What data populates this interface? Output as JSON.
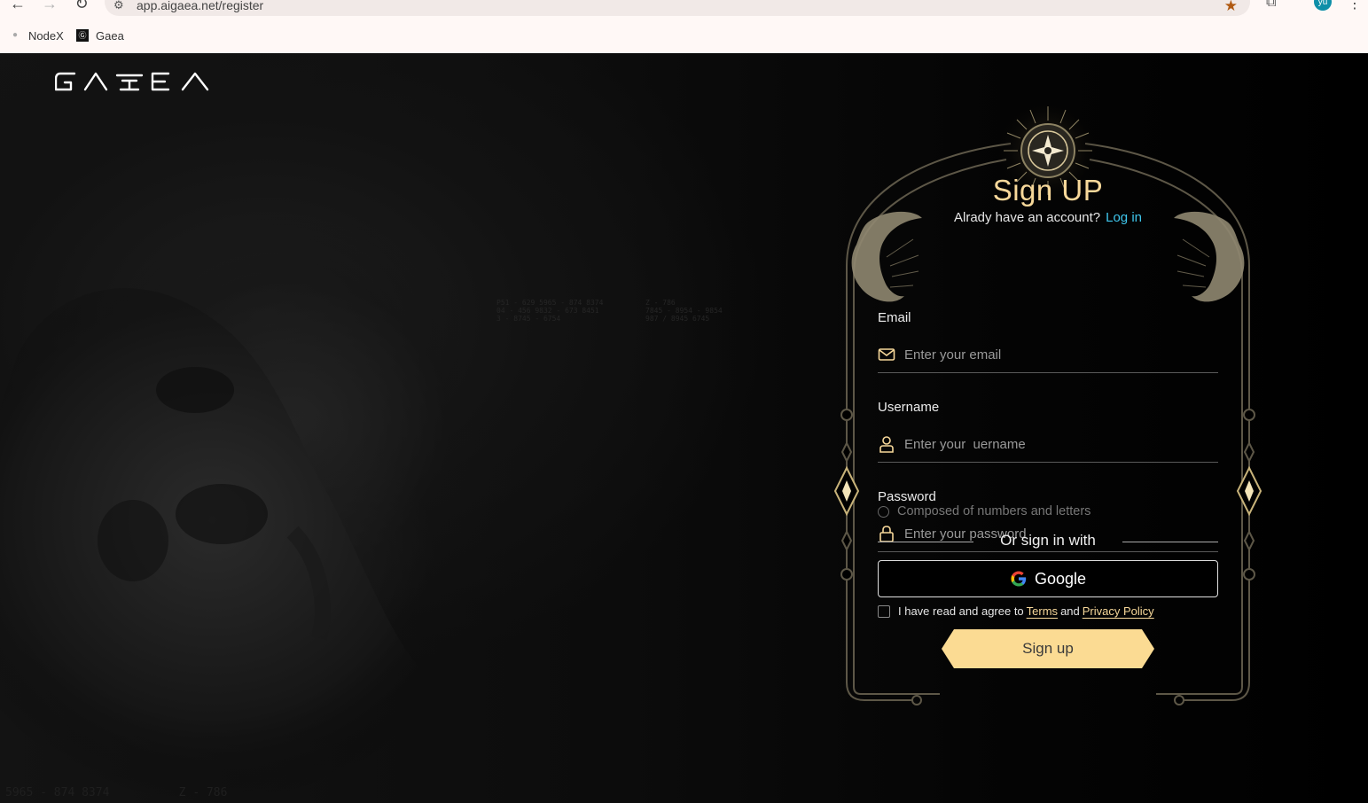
{
  "browser": {
    "url": "app.aigaea.net/register",
    "bookmarks": [
      {
        "label": "NodeX",
        "icon": "paw-icon"
      },
      {
        "label": "Gaea",
        "icon": "gaea-favicon"
      }
    ],
    "profile_initials": "yu"
  },
  "page": {
    "logo_text": "GAEA",
    "faint_text_1": "P51 - 629 5965 - 874 8374\n04 - 456 9832 - 673 8451\n3 - 8745 - 6754",
    "faint_text_2": "Z - 786\n7845 - 8954 - 9854\n987 / 8945 6745",
    "faint_text_3": "5965 - 874 8374          Z - 786"
  },
  "form": {
    "title": "Sign UP",
    "have_account": "Alrady have an account?",
    "login_link": "Log in",
    "email": {
      "label": "Email",
      "placeholder": "Enter your email",
      "value": ""
    },
    "username": {
      "label": "Username",
      "placeholder": "Enter your  uername",
      "value": ""
    },
    "password": {
      "label": "Password",
      "placeholder": "Enter your password",
      "value": ""
    },
    "password_hint": "Composed of numbers and letters",
    "or_text": "Or sign in with",
    "google_label": "Google",
    "agree_prefix": "I have read and agree to",
    "terms": "Terms",
    "agree_and": "and",
    "privacy": "Privacy Policy",
    "signup_label": "Sign up"
  },
  "colors": {
    "accent_gold": "#f7d89a",
    "button_gold": "#fbdb93",
    "link_cyan": "#3fc6ec",
    "frame_line": "#5d5747"
  }
}
